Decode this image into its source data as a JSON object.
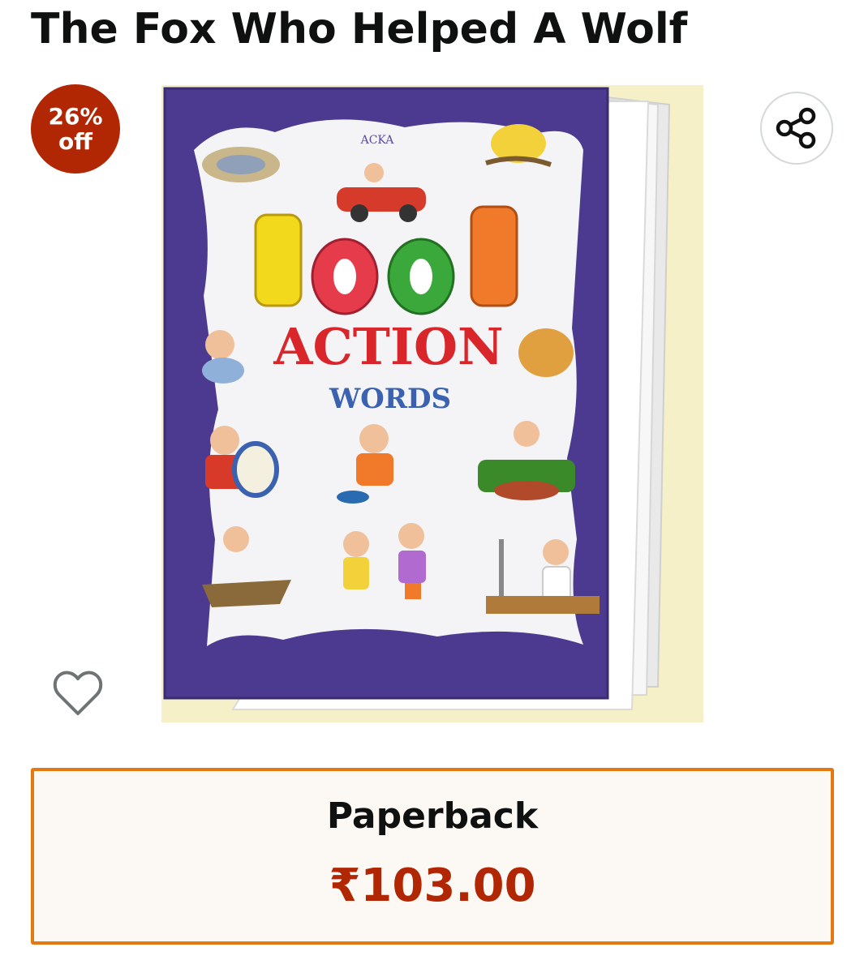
{
  "product": {
    "title": "The Fox Who Helped A Wolf",
    "discount_badge": {
      "percent": "26%",
      "suffix": "off"
    },
    "image": {
      "cover_publisher": "ACKA",
      "cover_title_number": "1001",
      "cover_title_main": "ACTION",
      "cover_title_sub": "WORDS"
    }
  },
  "actions": {
    "share_icon": "share-icon",
    "wishlist_icon": "heart-outline-icon"
  },
  "format_option": {
    "label": "Paperback",
    "price": "₹103.00",
    "selected": true
  },
  "colors": {
    "badge": "#b12704",
    "price": "#b12704",
    "selected_border": "#e47911",
    "cover_purple": "#4b3a8f",
    "background_cream": "#f6f0c8"
  }
}
